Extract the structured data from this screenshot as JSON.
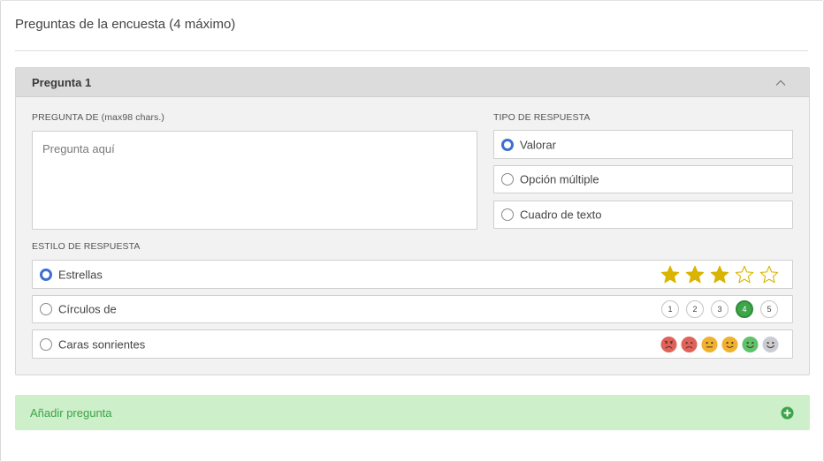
{
  "page": {
    "title": "Preguntas de la encuesta (4 máximo)"
  },
  "question": {
    "header": "Pregunta 1",
    "text_label": "PREGUNTA DE (max98 chars.)",
    "text_placeholder": "Pregunta aquí",
    "response_type_label": "TIPO DE RESPUESTA",
    "response_types": [
      {
        "label": "Valorar",
        "selected": true
      },
      {
        "label": "Opción múltiple",
        "selected": false
      },
      {
        "label": "Cuadro de texto",
        "selected": false
      }
    ],
    "response_style_label": "ESTILO DE RESPUESTA",
    "response_styles": [
      {
        "label": "Estrellas",
        "selected": true,
        "rating": 3,
        "max": 5
      },
      {
        "label": "Círculos de",
        "selected": false,
        "numbers": [
          "1",
          "2",
          "3",
          "4",
          "5"
        ],
        "active": "4"
      },
      {
        "label": "Caras sonrientes",
        "selected": false,
        "faces": [
          "very-sad-face-icon",
          "sad-face-icon",
          "neutral-face-icon",
          "slight-smile-face-icon",
          "happy-face-icon",
          "very-happy-face-icon"
        ]
      }
    ]
  },
  "add_question": {
    "label": "Añadir pregunta",
    "icon": "plus-circle-icon"
  },
  "colors": {
    "accent_blue": "#3d6fd1",
    "star_gold": "#d9b400",
    "add_green": "#3da34a",
    "add_bg": "#cdefc9"
  }
}
